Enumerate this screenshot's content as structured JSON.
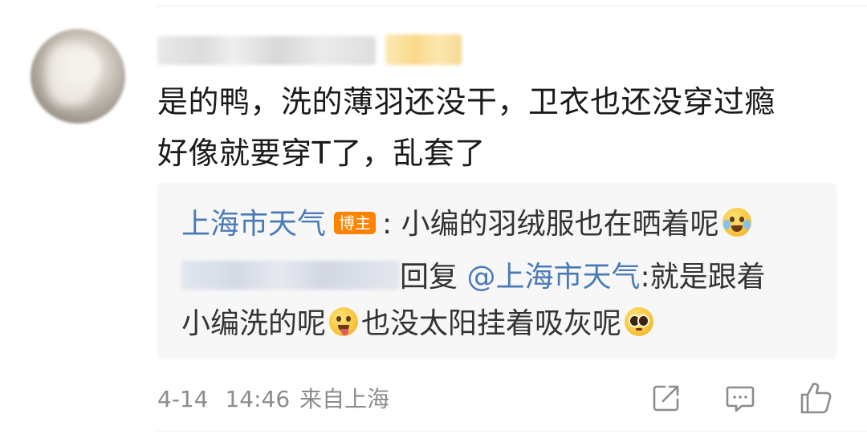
{
  "comment": {
    "text": "是的鸭，洗的薄羽还没干，卫衣也还没穿过瘾\n好像就要穿T了，乱套了"
  },
  "reply_box": {
    "first": {
      "author": "上海市天气",
      "badge": "博主",
      "text": ": 小编的羽绒服也在晒着呢",
      "emoji": "laughing-tears-emoji"
    },
    "second": {
      "reply_word": "回复",
      "mention": "@上海市天气",
      "text_part1": ":就是跟着",
      "text_part2": "小编洗的呢",
      "emoji1": "tongue-out-emoji",
      "text_part3": "也没太阳挂着吸灰呢",
      "emoji2": "pleading-emoji"
    }
  },
  "meta": {
    "date": "4-14",
    "time": "14:46",
    "location": "来自上海"
  },
  "actions": {
    "share_icon": "share-icon",
    "comment_icon": "comment-icon",
    "like_icon": "like-icon"
  },
  "colors": {
    "link": "#4a7bb8",
    "badge": "#ff8200",
    "meta_text": "#8c8c8c",
    "reply_bg": "#f7f7f7"
  }
}
